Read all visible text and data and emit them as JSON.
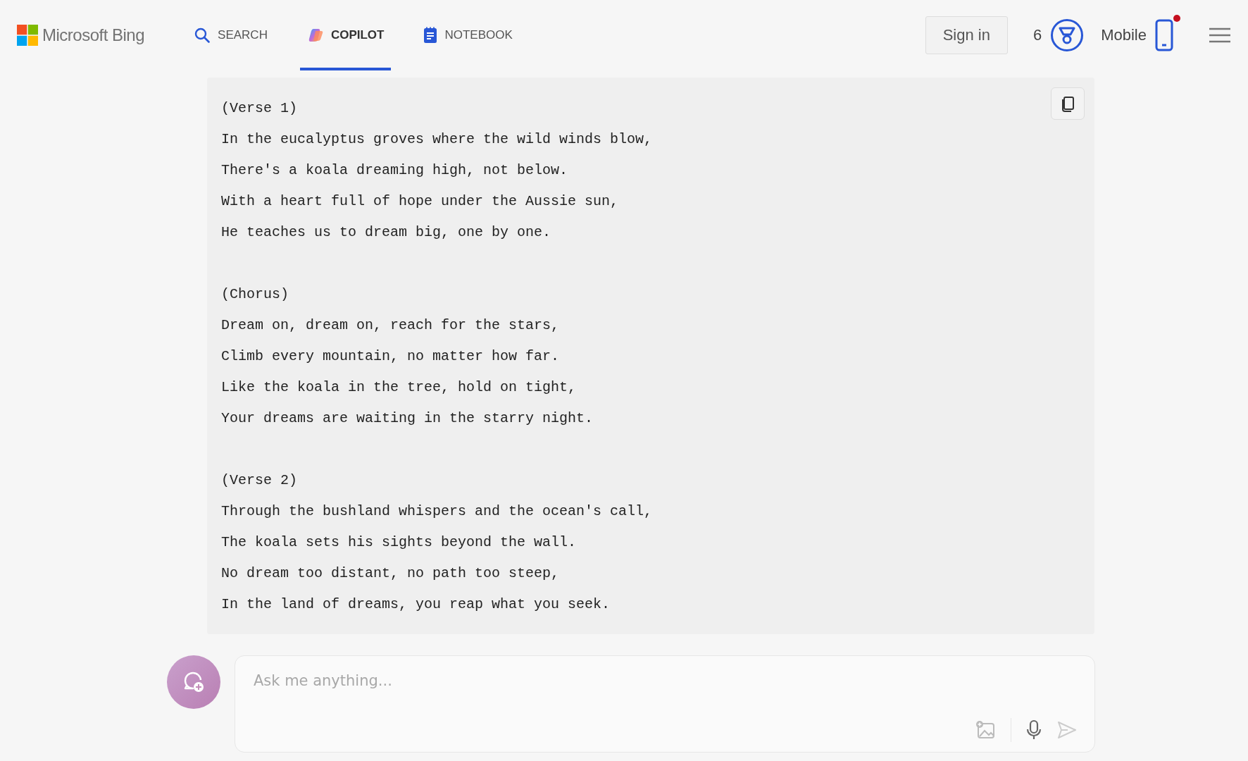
{
  "header": {
    "logo": "Microsoft Bing",
    "tabs": [
      {
        "label": "SEARCH",
        "kind": "search",
        "selected": false
      },
      {
        "label": "COPILOT",
        "kind": "copilot",
        "selected": true
      },
      {
        "label": "NOTEBOOK",
        "kind": "notebook",
        "selected": false
      }
    ],
    "sign_in": "Sign in",
    "rewards_count": "6",
    "mobile": "Mobile",
    "mobile_notification": true
  },
  "code_block": {
    "stanzas": [
      {
        "lines": [
          "(Verse 1)",
          "In the eucalyptus groves where the wild winds blow,",
          "There's a koala dreaming high, not below.",
          "With a heart full of hope under the Aussie sun,",
          "He teaches us to dream big, one by one."
        ]
      },
      {
        "lines": [
          "(Chorus)",
          "Dream on, dream on, reach for the stars,",
          "Climb every mountain, no matter how far.",
          "Like the koala in the tree, hold on tight,",
          "Your dreams are waiting in the starry night."
        ]
      },
      {
        "lines": [
          "(Verse 2)",
          "Through the bushland whispers and the ocean's call,",
          "The koala sets his sights beyond the wall.",
          "No dream too distant, no path too steep,",
          "In the land of dreams, you reap what you seek."
        ]
      }
    ]
  },
  "composer": {
    "placeholder": "Ask me anything..."
  }
}
